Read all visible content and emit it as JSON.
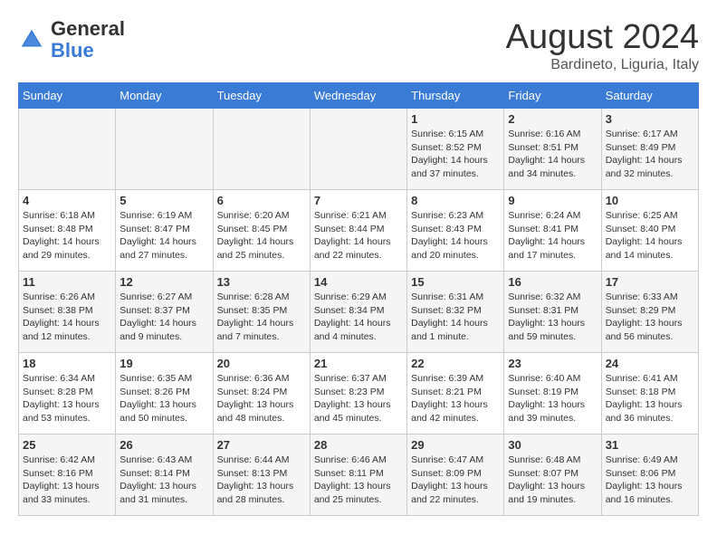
{
  "header": {
    "logo_general": "General",
    "logo_blue": "Blue",
    "month_year": "August 2024",
    "location": "Bardineto, Liguria, Italy"
  },
  "days_of_week": [
    "Sunday",
    "Monday",
    "Tuesday",
    "Wednesday",
    "Thursday",
    "Friday",
    "Saturday"
  ],
  "weeks": [
    [
      {
        "day": "",
        "info": ""
      },
      {
        "day": "",
        "info": ""
      },
      {
        "day": "",
        "info": ""
      },
      {
        "day": "",
        "info": ""
      },
      {
        "day": "1",
        "info": "Sunrise: 6:15 AM\nSunset: 8:52 PM\nDaylight: 14 hours and 37 minutes."
      },
      {
        "day": "2",
        "info": "Sunrise: 6:16 AM\nSunset: 8:51 PM\nDaylight: 14 hours and 34 minutes."
      },
      {
        "day": "3",
        "info": "Sunrise: 6:17 AM\nSunset: 8:49 PM\nDaylight: 14 hours and 32 minutes."
      }
    ],
    [
      {
        "day": "4",
        "info": "Sunrise: 6:18 AM\nSunset: 8:48 PM\nDaylight: 14 hours and 29 minutes."
      },
      {
        "day": "5",
        "info": "Sunrise: 6:19 AM\nSunset: 8:47 PM\nDaylight: 14 hours and 27 minutes."
      },
      {
        "day": "6",
        "info": "Sunrise: 6:20 AM\nSunset: 8:45 PM\nDaylight: 14 hours and 25 minutes."
      },
      {
        "day": "7",
        "info": "Sunrise: 6:21 AM\nSunset: 8:44 PM\nDaylight: 14 hours and 22 minutes."
      },
      {
        "day": "8",
        "info": "Sunrise: 6:23 AM\nSunset: 8:43 PM\nDaylight: 14 hours and 20 minutes."
      },
      {
        "day": "9",
        "info": "Sunrise: 6:24 AM\nSunset: 8:41 PM\nDaylight: 14 hours and 17 minutes."
      },
      {
        "day": "10",
        "info": "Sunrise: 6:25 AM\nSunset: 8:40 PM\nDaylight: 14 hours and 14 minutes."
      }
    ],
    [
      {
        "day": "11",
        "info": "Sunrise: 6:26 AM\nSunset: 8:38 PM\nDaylight: 14 hours and 12 minutes."
      },
      {
        "day": "12",
        "info": "Sunrise: 6:27 AM\nSunset: 8:37 PM\nDaylight: 14 hours and 9 minutes."
      },
      {
        "day": "13",
        "info": "Sunrise: 6:28 AM\nSunset: 8:35 PM\nDaylight: 14 hours and 7 minutes."
      },
      {
        "day": "14",
        "info": "Sunrise: 6:29 AM\nSunset: 8:34 PM\nDaylight: 14 hours and 4 minutes."
      },
      {
        "day": "15",
        "info": "Sunrise: 6:31 AM\nSunset: 8:32 PM\nDaylight: 14 hours and 1 minute."
      },
      {
        "day": "16",
        "info": "Sunrise: 6:32 AM\nSunset: 8:31 PM\nDaylight: 13 hours and 59 minutes."
      },
      {
        "day": "17",
        "info": "Sunrise: 6:33 AM\nSunset: 8:29 PM\nDaylight: 13 hours and 56 minutes."
      }
    ],
    [
      {
        "day": "18",
        "info": "Sunrise: 6:34 AM\nSunset: 8:28 PM\nDaylight: 13 hours and 53 minutes."
      },
      {
        "day": "19",
        "info": "Sunrise: 6:35 AM\nSunset: 8:26 PM\nDaylight: 13 hours and 50 minutes."
      },
      {
        "day": "20",
        "info": "Sunrise: 6:36 AM\nSunset: 8:24 PM\nDaylight: 13 hours and 48 minutes."
      },
      {
        "day": "21",
        "info": "Sunrise: 6:37 AM\nSunset: 8:23 PM\nDaylight: 13 hours and 45 minutes."
      },
      {
        "day": "22",
        "info": "Sunrise: 6:39 AM\nSunset: 8:21 PM\nDaylight: 13 hours and 42 minutes."
      },
      {
        "day": "23",
        "info": "Sunrise: 6:40 AM\nSunset: 8:19 PM\nDaylight: 13 hours and 39 minutes."
      },
      {
        "day": "24",
        "info": "Sunrise: 6:41 AM\nSunset: 8:18 PM\nDaylight: 13 hours and 36 minutes."
      }
    ],
    [
      {
        "day": "25",
        "info": "Sunrise: 6:42 AM\nSunset: 8:16 PM\nDaylight: 13 hours and 33 minutes."
      },
      {
        "day": "26",
        "info": "Sunrise: 6:43 AM\nSunset: 8:14 PM\nDaylight: 13 hours and 31 minutes."
      },
      {
        "day": "27",
        "info": "Sunrise: 6:44 AM\nSunset: 8:13 PM\nDaylight: 13 hours and 28 minutes."
      },
      {
        "day": "28",
        "info": "Sunrise: 6:46 AM\nSunset: 8:11 PM\nDaylight: 13 hours and 25 minutes."
      },
      {
        "day": "29",
        "info": "Sunrise: 6:47 AM\nSunset: 8:09 PM\nDaylight: 13 hours and 22 minutes."
      },
      {
        "day": "30",
        "info": "Sunrise: 6:48 AM\nSunset: 8:07 PM\nDaylight: 13 hours and 19 minutes."
      },
      {
        "day": "31",
        "info": "Sunrise: 6:49 AM\nSunset: 8:06 PM\nDaylight: 13 hours and 16 minutes."
      }
    ]
  ]
}
